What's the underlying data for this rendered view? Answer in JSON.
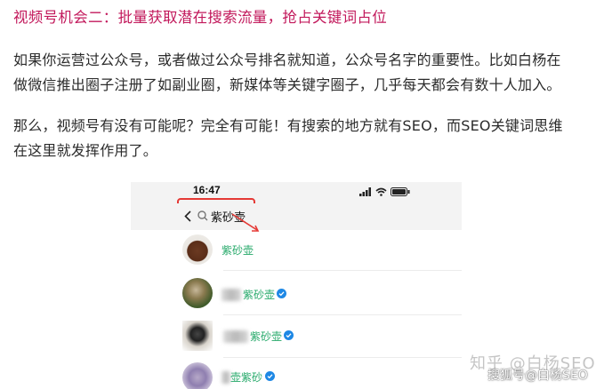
{
  "article": {
    "heading": "视频号机会二：批量获取潜在搜索流量，抢占关键词占位",
    "paragraph1_line1": "如果你运营过公众号，或者做过公众号排名就知道，公众号名字的重要性。比如白杨在",
    "paragraph1_line2": "做微信推出圈子注册了如副业圈，新媒体等关键字圈子，几乎每天都会有数十人加入。",
    "paragraph2_line1": "那么，视频号有没有可能呢？完全有可能！有搜索的地方就有SEO，而SEO关键词思维",
    "paragraph2_line2": "在这里就发挥作用了。"
  },
  "screenshot": {
    "status_time": "16:47",
    "search_value": "紫砂壶",
    "results": [
      {
        "name": "紫砂壶",
        "verified": false
      },
      {
        "name": "紫砂壶",
        "verified": true
      },
      {
        "name": "紫砂壶",
        "verified": true
      },
      {
        "name": "壶紫砂",
        "verified": true
      }
    ]
  },
  "watermarks": {
    "zhihu": "知乎 @白杨SEO",
    "sohu": "搜狐号@白杨SEO"
  },
  "colors": {
    "heading": "#c2185b",
    "highlight": "#e53935",
    "result_name": "#26a96a",
    "verified_badge": "#1e88e5"
  }
}
